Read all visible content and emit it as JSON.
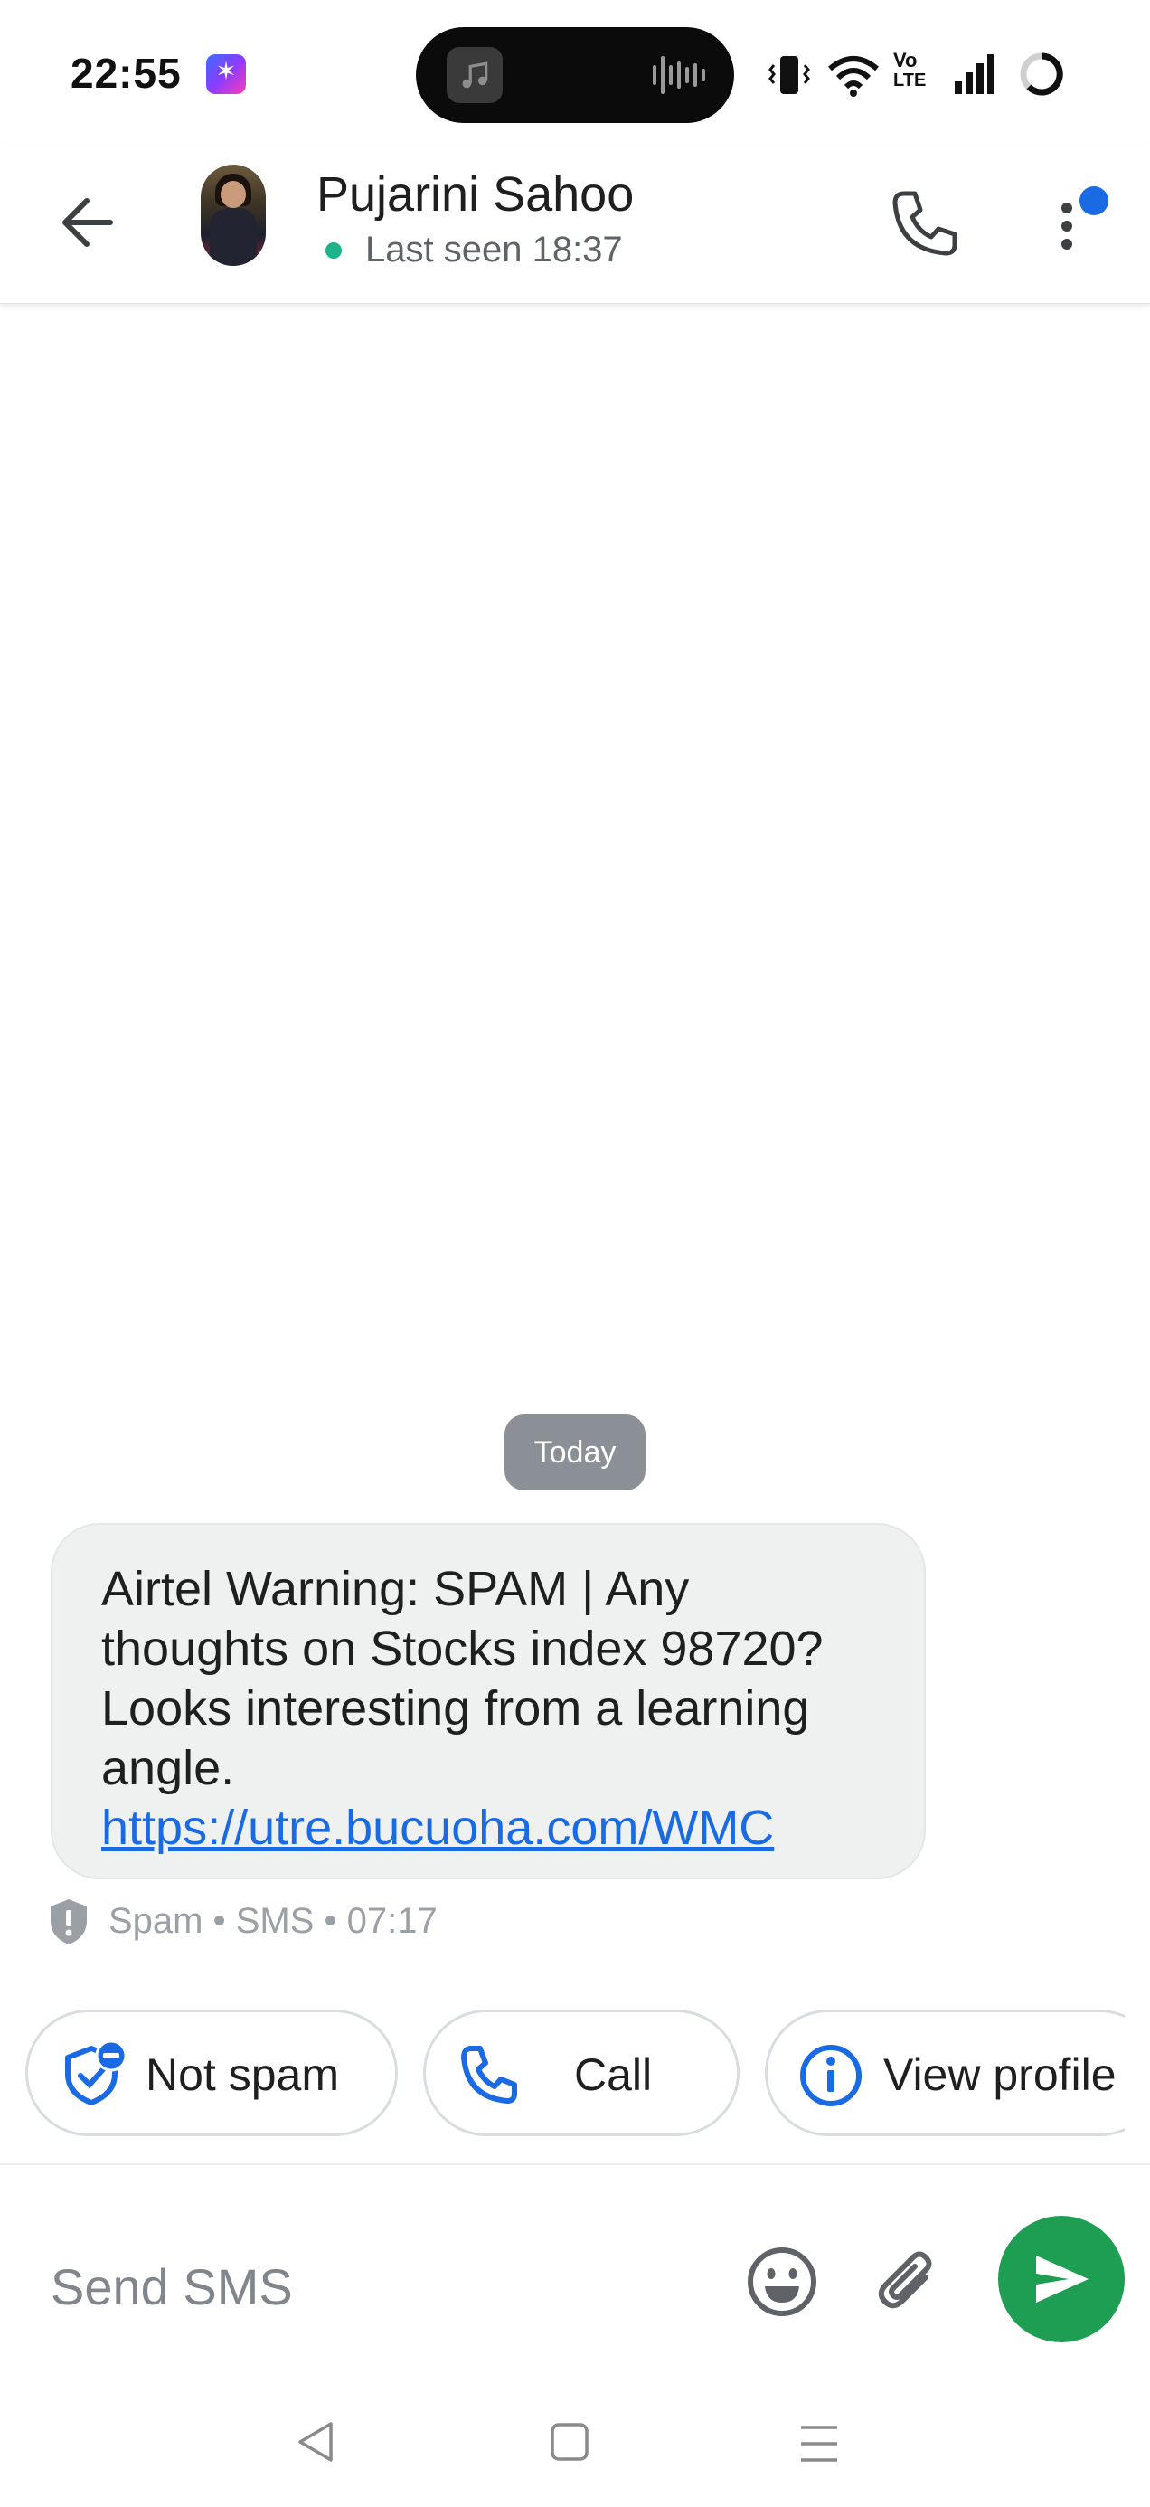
{
  "status_bar": {
    "time": "22:55",
    "icons": [
      "app-sparkle-icon",
      "music-icon",
      "audio-wave-icon",
      "vibrate-icon",
      "wifi-icon",
      "volte-icon",
      "signal-icon",
      "battery-ring-icon"
    ],
    "volte_label_top": "Vo",
    "volte_label_bottom": "LTE"
  },
  "header": {
    "contact_name": "Pujarini Sahoo",
    "last_seen": "Last seen 18:37",
    "presence_color": "#1bb38a",
    "icons": [
      "back-arrow-icon",
      "avatar",
      "phone-icon",
      "more-vert-icon"
    ],
    "notification_dot_color": "#1a6ae3"
  },
  "chat": {
    "date_chip": "Today",
    "message": {
      "text_lines": [
        "Airtel Warning: SPAM | Any",
        "thoughts on Stocks index 98720?",
        "Looks interesting from a learning",
        "angle."
      ],
      "link": "https://utre.bucuoha.com/WMC",
      "meta": "Spam • SMS • 07:17"
    }
  },
  "actions": [
    {
      "label": "Not spam",
      "icon": "shield-minus-icon"
    },
    {
      "label": "Call",
      "icon": "phone-icon"
    },
    {
      "label": "View profile",
      "icon": "info-icon"
    }
  ],
  "composer": {
    "placeholder": "Send SMS",
    "icons": [
      "emoji-icon",
      "attach-icon",
      "send-icon"
    ],
    "send_color": "#1e9e52"
  },
  "navbar": {
    "icons": [
      "nav-back-icon",
      "nav-home-icon",
      "nav-menu-icon"
    ]
  }
}
